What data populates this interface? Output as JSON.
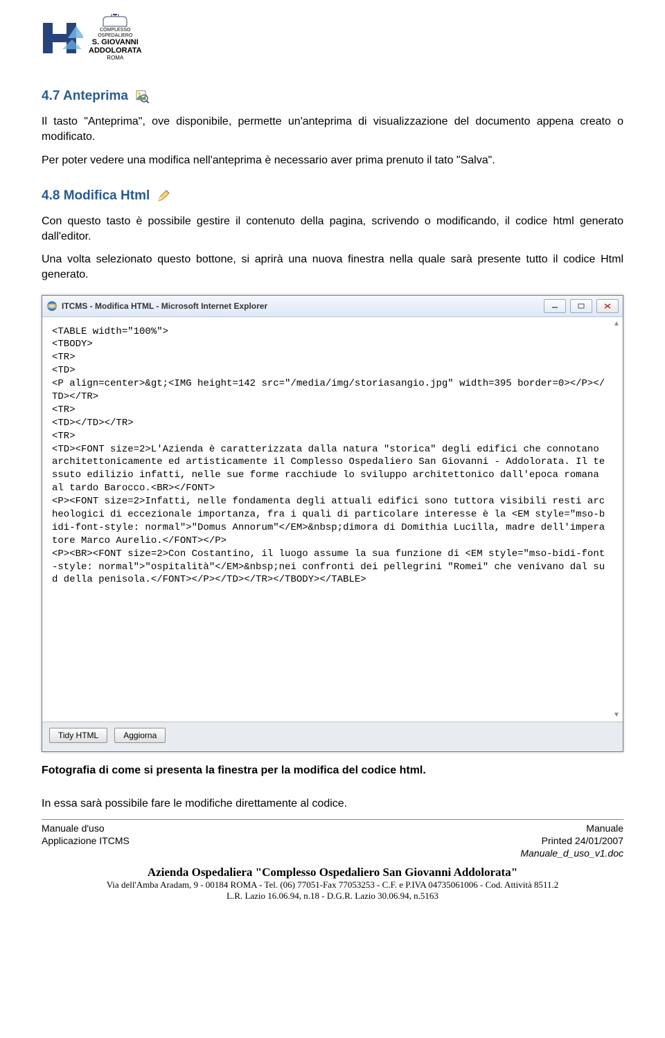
{
  "logo": {
    "top": "COMPLESSO",
    "mid": "OSPEDALIERO",
    "name1": "S. GIOVANNI",
    "name2": "ADDOLORATA",
    "city": "ROMA"
  },
  "section47": {
    "heading": "4.7 Anteprima",
    "p1": "Il tasto \"Anteprima\", ove disponibile, permette un'anteprima di visualizzazione del documento appena creato o modificato.",
    "p2": "Per poter vedere una modifica nell'anteprima è necessario aver prima prenuto il tato \"Salva\"."
  },
  "section48": {
    "heading": "4.8 Modifica Html",
    "p1": "Con questo tasto è possibile gestire il contenuto della pagina, scrivendo o modificando, il codice html generato dall'editor.",
    "p2": "Una volta selezionato questo bottone, si aprirà una nuova finestra nella quale sarà presente tutto il codice Html generato."
  },
  "iewindow": {
    "title": "ITCMS - Modifica HTML - Microsoft Internet Explorer",
    "code": "<TABLE width=\"100%\">\n<TBODY>\n<TR>\n<TD>\n<P align=center>&gt;<IMG height=142 src=\"/media/img/storiasangio.jpg\" width=395 border=0></P></TD></TR>\n<TR>\n<TD></TD></TR>\n<TR>\n<TD><FONT size=2>L'Azienda è caratterizzata dalla natura \"storica\" degli edifici che connotano architettonicamente ed artisticamente il Complesso Ospedaliero San Giovanni - Addolorata. Il tessuto edilizio infatti, nelle sue forme racchiude lo sviluppo architettonico dall'epoca romana al tardo Barocco.<BR></FONT>\n<P><FONT size=2>Infatti, nelle fondamenta degli attuali edifici sono tuttora visibili resti archeologici di eccezionale importanza, fra i quali di particolare interesse è la <EM style=\"mso-bidi-font-style: normal\">\"Domus Annorum\"</EM>&nbsp;dimora di Domithia Lucilla, madre dell'imperatore Marco Aurelio.</FONT></P>\n<P><BR><FONT size=2>Con Costantino, il luogo assume la sua funzione di <EM style=\"mso-bidi-font-style: normal\">\"ospitalità\"</EM>&nbsp;nei confronti dei pellegrini \"Romei\" che venivano dal sud della penisola.</FONT></P></TD></TR></TBODY></TABLE>",
    "btn_tidy": "Tidy HTML",
    "btn_refresh": "Aggiorna"
  },
  "caption": "Fotografia di come si presenta la finestra per la modifica del codice html.",
  "closing": "In essa sarà possibile fare le modifiche direttamente al codice.",
  "footer": {
    "left1": "Manuale d'uso",
    "left2": "Applicazione ITCMS",
    "right1": "Manuale",
    "right2": "Printed 24/01/2007",
    "right3": "Manuale_d_uso_v1.doc",
    "org": "Azienda Ospedaliera \"Complesso Ospedaliero San Giovanni  Addolorata\"",
    "addr": "Via dell'Amba Aradam, 9 - 00184 ROMA - Tel. (06) 77051-Fax 77053253 - C.F. e P.IVA 04735061006 - Cod. Attività 8511.2",
    "law": "L.R. Lazio 16.06.94, n.18 - D.G.R. Lazio 30.06.94, n.5163"
  }
}
